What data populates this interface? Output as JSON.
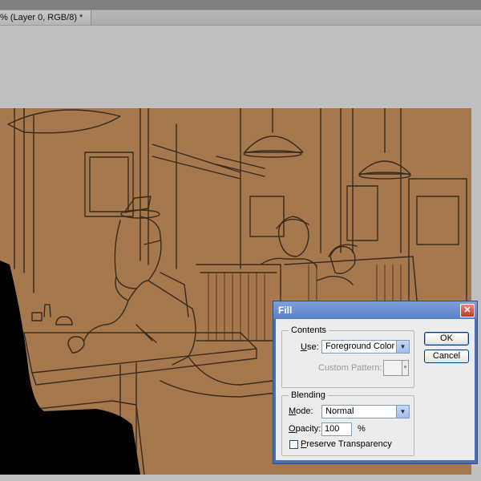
{
  "window": {
    "tab_title": "% (Layer 0, RGB/8) *"
  },
  "canvas": {
    "background_color": "#a6784e",
    "description_icon": "illustration-diner-sketch"
  },
  "fill_dialog": {
    "title": "Fill",
    "close_glyph": "✕",
    "contents": {
      "legend": "Contents",
      "use_label": "Use:",
      "use_value": "Foreground Color",
      "custom_pattern_label": "Custom Pattern:"
    },
    "blending": {
      "legend": "Blending",
      "mode_label": "Mode:",
      "mode_value": "Normal",
      "opacity_label": "Opacity:",
      "opacity_value": "100",
      "opacity_unit": "%",
      "preserve_label": "Preserve Transparency",
      "preserve_checked": false
    },
    "buttons": {
      "ok": "OK",
      "cancel": "Cancel"
    }
  }
}
